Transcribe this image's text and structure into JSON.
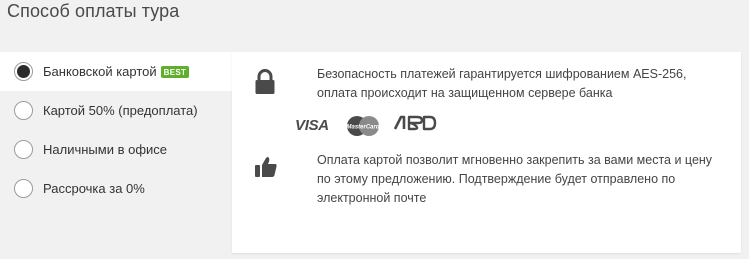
{
  "page": {
    "title": "Способ оплаты тура"
  },
  "options": [
    {
      "label": "Банковской картой",
      "badge": "BEST",
      "checked": true
    },
    {
      "label": "Картой 50% (предоплата)",
      "checked": false
    },
    {
      "label": "Наличными в офисе",
      "checked": false
    },
    {
      "label": "Рассрочка за 0%",
      "checked": false
    }
  ],
  "panel": {
    "security_text": "Безопасность платежей гарантируется шифрованием AES-256, оплата происходит на защищенном сервере банка",
    "security_icon": "lock-icon",
    "card_logos": [
      {
        "name": "visa-logo",
        "text": "VISA"
      },
      {
        "name": "mastercard-logo",
        "text": "MasterCard"
      },
      {
        "name": "mir-logo",
        "text": "МИР"
      }
    ],
    "benefit_text": "Оплата картой позволит мгновенно закрепить за вами места и цену по этому предложению. Подтверждение будет отправлено по электронной почте",
    "benefit_icon": "thumbs-up-icon"
  },
  "colors": {
    "background": "#f1f1f1",
    "panel": "#ffffff",
    "badge": "#5fae2c",
    "icon": "#4a4a4a"
  }
}
